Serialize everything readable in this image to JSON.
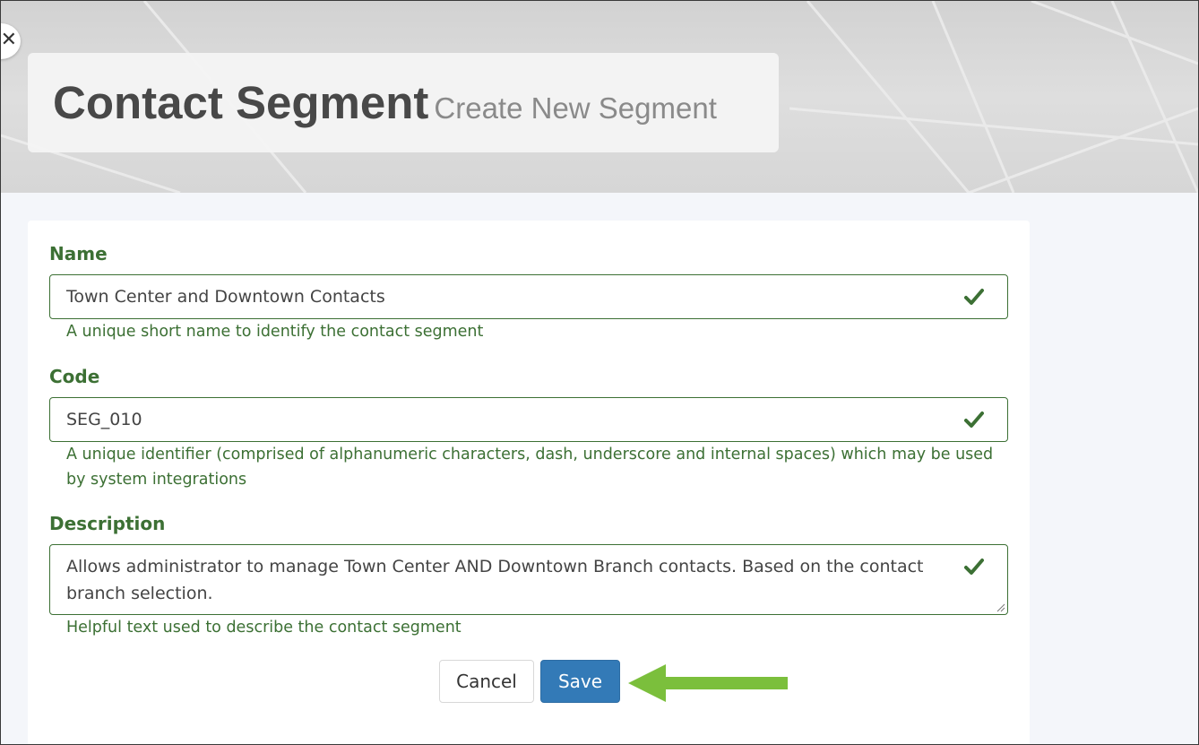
{
  "header": {
    "back_icon": "close-icon",
    "back_glyph": "✕",
    "title": "Contact Segment",
    "subtitle": "Create New Segment"
  },
  "form": {
    "name": {
      "label": "Name",
      "value": "Town Center and Downtown Contacts",
      "help": "A unique short name to identify the contact segment",
      "valid": true
    },
    "code": {
      "label": "Code",
      "value": "SEG_010",
      "help": "A unique identifier (comprised of alphanumeric characters, dash, underscore and internal spaces) which may be used by system integrations",
      "valid": true
    },
    "description": {
      "label": "Description",
      "value": "Allows administrator to manage Town Center AND Downtown Branch contacts. Based on the contact branch selection.",
      "help": "Helpful text used to describe the contact segment",
      "valid": true
    }
  },
  "actions": {
    "cancel_label": "Cancel",
    "save_label": "Save"
  },
  "annotation": {
    "arrow_icon": "arrow-left-icon",
    "arrow_color": "#7bbf3c"
  },
  "colors": {
    "valid_green": "#3c7034",
    "primary": "#337ab7"
  }
}
